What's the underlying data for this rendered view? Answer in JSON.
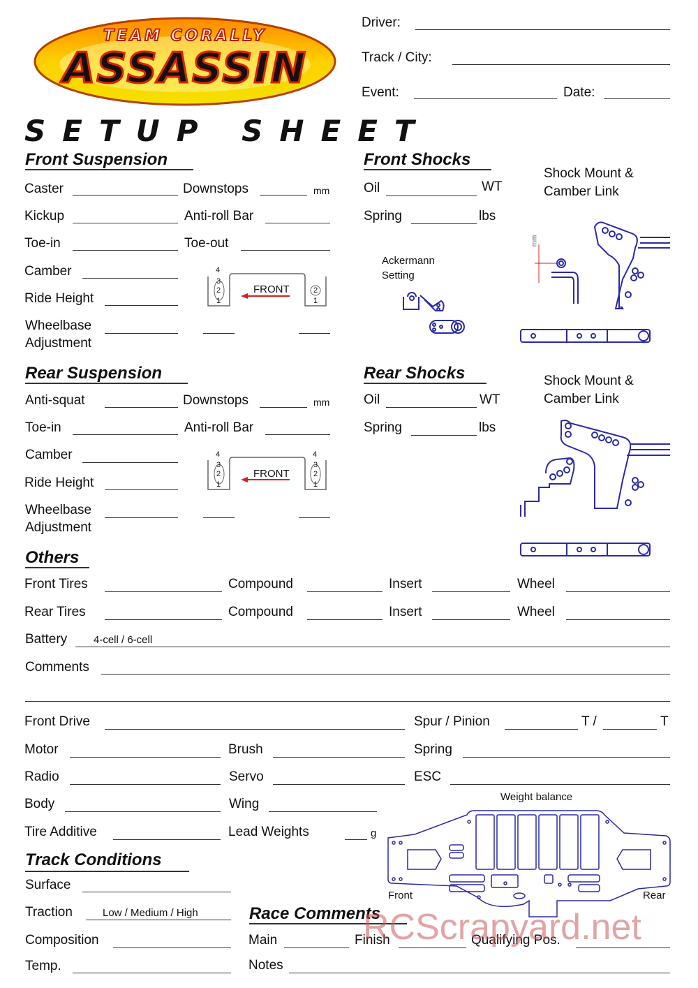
{
  "logo": {
    "top_text": "TEAM CORALLY",
    "main_text": "ASSASSIN"
  },
  "header": {
    "driver": "Driver:",
    "track": "Track / City:",
    "event": "Event:",
    "date": "Date:"
  },
  "title": "SETUP SHEET",
  "front_suspension": {
    "heading": "Front Suspension",
    "caster": "Caster",
    "downstops": "Downstops",
    "mm": "mm",
    "kickup": "Kickup",
    "anti_roll": "Anti-roll Bar",
    "toe_in": "Toe-in",
    "toe_out": "Toe-out",
    "camber": "Camber",
    "ride_height": "Ride Height",
    "wheelbase": "Wheelbase",
    "adjustment": "Adjustment",
    "diagram": {
      "front": "FRONT",
      "left_positions": [
        "4",
        "3",
        "2",
        "1"
      ],
      "right_positions": [
        "2",
        "1"
      ]
    }
  },
  "front_shocks": {
    "heading": "Front Shocks",
    "oil": "Oil",
    "wt": "WT",
    "spring": "Spring",
    "lbs": "lbs",
    "shock_mount_1": "Shock Mount &",
    "shock_mount_2": "Camber Link",
    "ackermann_1": "Ackermann",
    "ackermann_2": "Setting",
    "mm_label": "mm"
  },
  "rear_suspension": {
    "heading": "Rear Suspension",
    "anti_squat": "Anti-squat",
    "downstops": "Downstops",
    "mm": "mm",
    "toe_in": "Toe-in",
    "anti_roll": "Anti-roll Bar",
    "camber": "Camber",
    "ride_height": "Ride Height",
    "wheelbase": "Wheelbase",
    "adjustment": "Adjustment",
    "diagram": {
      "front": "FRONT",
      "left_positions": [
        "4",
        "3",
        "2",
        "1"
      ],
      "right_positions": [
        "4",
        "3",
        "2",
        "1"
      ]
    }
  },
  "rear_shocks": {
    "heading": "Rear Shocks",
    "oil": "Oil",
    "wt": "WT",
    "spring": "Spring",
    "lbs": "lbs",
    "shock_mount_1": "Shock Mount &",
    "shock_mount_2": "Camber Link"
  },
  "others": {
    "heading": "Others",
    "front_tires": "Front Tires",
    "rear_tires": "Rear Tires",
    "compound": "Compound",
    "insert": "Insert",
    "wheel": "Wheel",
    "battery": "Battery",
    "battery_hint": "4-cell / 6-cell",
    "comments": "Comments"
  },
  "drivetrain": {
    "front_drive": "Front Drive",
    "spur_pinion": "Spur / Pinion",
    "t_slash": "T /",
    "t": "T",
    "motor": "Motor",
    "brush": "Brush",
    "spring": "Spring",
    "radio": "Radio",
    "servo": "Servo",
    "esc": "ESC",
    "body": "Body",
    "wing": "Wing",
    "tire_additive": "Tire Additive",
    "lead_weights": "Lead Weights",
    "g": "g"
  },
  "weight_balance": {
    "title": "Weight balance",
    "front": "Front",
    "rear": "Rear"
  },
  "track_conditions": {
    "heading": "Track Conditions",
    "surface": "Surface",
    "traction": "Traction",
    "traction_hint": "Low / Medium / High",
    "composition": "Composition",
    "temp": "Temp."
  },
  "race_comments": {
    "heading": "Race Comments",
    "main": "Main",
    "finish": "Finish",
    "qualifying": "Qualifying Pos.",
    "notes": "Notes"
  },
  "watermark": "RCScrapyard.net",
  "colors": {
    "diagram_blue": "#2a2aa8",
    "arrow_red": "#d42020",
    "watermark": "#c85a5a"
  }
}
